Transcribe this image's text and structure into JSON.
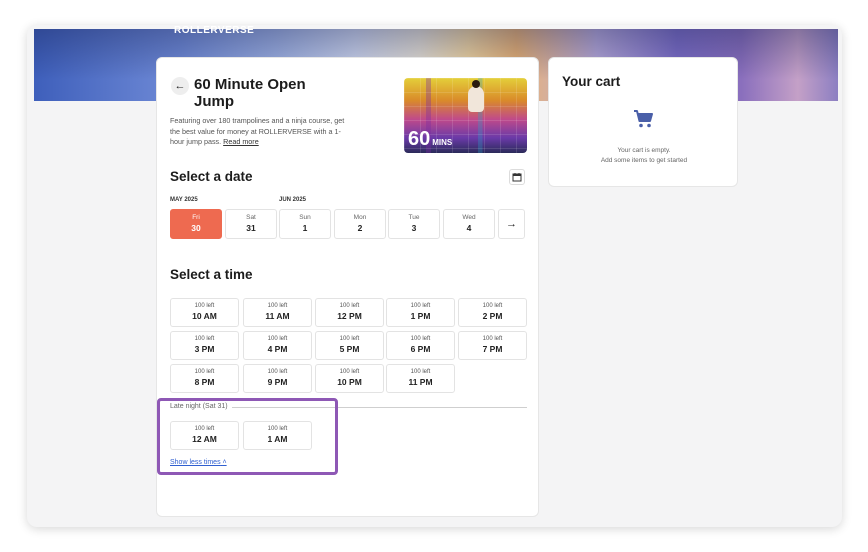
{
  "brand": "ROLLERVERSE",
  "product": {
    "title": "60 Minute Open Jump",
    "description": "Featuring over 180 trampolines and a ninja course, get the best value for money at ROLLERVERSE with a 1-hour jump pass.",
    "read_more": "Read more",
    "thumb_number": "60",
    "thumb_unit": "MINS"
  },
  "date_section": {
    "title": "Select a date",
    "month_1": "MAY 2025",
    "month_2": "JUN 2025",
    "dates": [
      {
        "dow": "Fri",
        "day": "30",
        "selected": true
      },
      {
        "dow": "Sat",
        "day": "31",
        "selected": false
      },
      {
        "dow": "Sun",
        "day": "1",
        "selected": false
      },
      {
        "dow": "Mon",
        "day": "2",
        "selected": false
      },
      {
        "dow": "Tue",
        "day": "3",
        "selected": false
      },
      {
        "dow": "Wed",
        "day": "4",
        "selected": false
      }
    ]
  },
  "time_section": {
    "title": "Select a time",
    "slots": [
      {
        "left": "100 left",
        "time": "10 AM"
      },
      {
        "left": "100 left",
        "time": "11 AM"
      },
      {
        "left": "100 left",
        "time": "12 PM"
      },
      {
        "left": "100 left",
        "time": "1 PM"
      },
      {
        "left": "100 left",
        "time": "2 PM"
      },
      {
        "left": "100 left",
        "time": "3 PM"
      },
      {
        "left": "100 left",
        "time": "4 PM"
      },
      {
        "left": "100 left",
        "time": "5 PM"
      },
      {
        "left": "100 left",
        "time": "6 PM"
      },
      {
        "left": "100 left",
        "time": "7 PM"
      },
      {
        "left": "100 left",
        "time": "8 PM"
      },
      {
        "left": "100 left",
        "time": "9 PM"
      },
      {
        "left": "100 left",
        "time": "10 PM"
      },
      {
        "left": "100 left",
        "time": "11 PM"
      }
    ],
    "late_night_label": "Late night (Sat 31)",
    "late_slots": [
      {
        "left": "100 left",
        "time": "12 AM"
      },
      {
        "left": "100 left",
        "time": "1 AM"
      }
    ],
    "show_less": "Show less times"
  },
  "cart": {
    "title": "Your cart",
    "empty_line_1": "Your cart is empty.",
    "empty_line_2": "Add some items to get started"
  },
  "colors": {
    "accent": "#ee6a50",
    "highlight": "#8e58b5",
    "link": "#2f5fd0",
    "cart_icon": "#4a5fa8"
  }
}
